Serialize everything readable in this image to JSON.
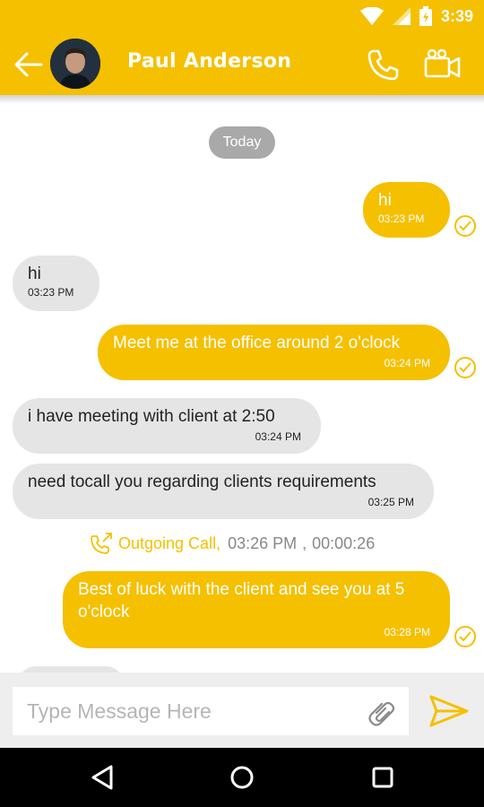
{
  "status_bar": {
    "time": "3:39",
    "icons": [
      "wifi-icon",
      "signal-icon",
      "battery-icon"
    ]
  },
  "header": {
    "contact_name": "Paul Anderson",
    "icons": [
      "back-arrow-icon",
      "avatar",
      "phone-icon",
      "video-camera-icon"
    ]
  },
  "chat": {
    "date_chip": "Today",
    "messages": [
      {
        "direction": "out",
        "text": "hi",
        "time": "03:23 PM"
      },
      {
        "direction": "in",
        "text": "hi",
        "time": "03:23 PM"
      },
      {
        "direction": "out",
        "text": "Meet me at the office around 2 o'clock",
        "time": "03:24 PM"
      },
      {
        "direction": "in",
        "text": "i have meeting with client at 2:50",
        "time": "03:24 PM"
      },
      {
        "direction": "in",
        "text": "need tocall you regarding clients requirements",
        "time": "03:25 PM"
      },
      {
        "direction": "out",
        "text": "Best of luck with the client and see you at 5 o'clock",
        "time": "03:28 PM"
      }
    ],
    "call_log": {
      "label": "Outgoing Call,",
      "time": "03:26 PM",
      "separator": ",",
      "duration": "00:00:26"
    }
  },
  "composer": {
    "placeholder": "Type Message Here",
    "value": ""
  },
  "colors": {
    "accent": "#f5c000",
    "incoming_bubble": "#e5e5e5",
    "date_chip": "#a9a9a9"
  }
}
